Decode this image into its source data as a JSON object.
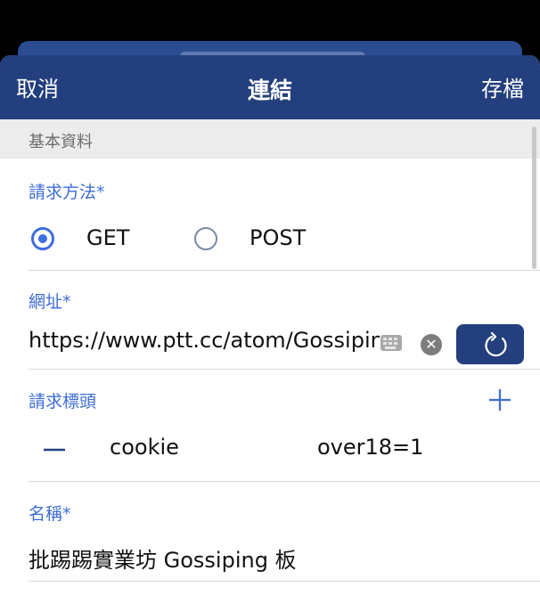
{
  "navbar": {
    "cancel_label": "取消",
    "title": "連結",
    "save_label": "存檔"
  },
  "section": {
    "basic_info": "基本資料"
  },
  "method": {
    "label": "請求方法*",
    "options": [
      "GET",
      "POST"
    ],
    "selected": "GET"
  },
  "url": {
    "label": "網址*",
    "value": "https://www.ptt.cc/atom/Gossiping"
  },
  "headers": {
    "label": "請求標頭",
    "rows": [
      {
        "key": "cookie",
        "value": "over18=1"
      }
    ]
  },
  "name": {
    "label": "名稱*",
    "value": "批踢踢實業坊 Gossiping 板"
  },
  "icons": {
    "keyboard": "keyboard-icon",
    "clear": "clear-icon",
    "reload": "reload-icon",
    "add": "plus-icon",
    "remove": "minus-icon"
  },
  "colors": {
    "navbar": "#233f7e",
    "accent": "#3d6dd6",
    "section_bg": "#ececec"
  }
}
